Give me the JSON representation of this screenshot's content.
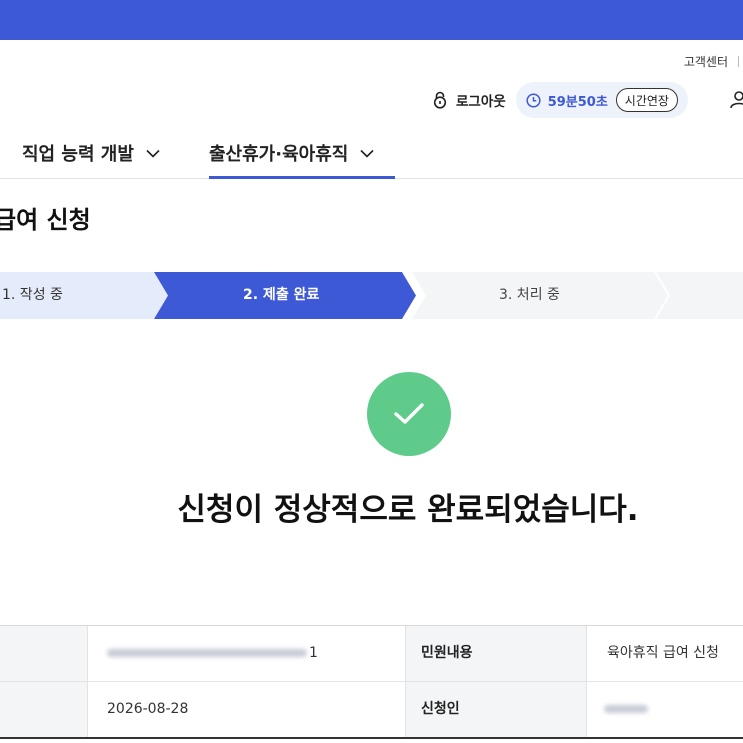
{
  "header": {
    "util_link": "고객센터",
    "logout_label": "로그아웃",
    "timer": "59분50초",
    "extend_label": "시간연장"
  },
  "nav": {
    "items": [
      {
        "label": "직업 능력 개발"
      },
      {
        "label": "출산휴가·육아휴직"
      }
    ]
  },
  "page": {
    "title": "급여 신청"
  },
  "steps": [
    {
      "label": "1. 작성 중",
      "state": "done"
    },
    {
      "label": "2. 제출 완료",
      "state": "current"
    },
    {
      "label": "3. 처리 중",
      "state": "pending"
    }
  ],
  "result": {
    "message": "신청이 정상적으로 완료되었습니다."
  },
  "info": {
    "receipt_suffix": "1",
    "date": "2026-08-28",
    "complaint_header": "민원내용",
    "complaint_value": "육아휴직 급여 신청",
    "applicant_header": "신청인"
  },
  "colors": {
    "brand": "#3e59d6",
    "success": "#5ecb8a",
    "step_done_bg": "#e4ecfb",
    "step_pending_bg": "#f4f5f7"
  }
}
